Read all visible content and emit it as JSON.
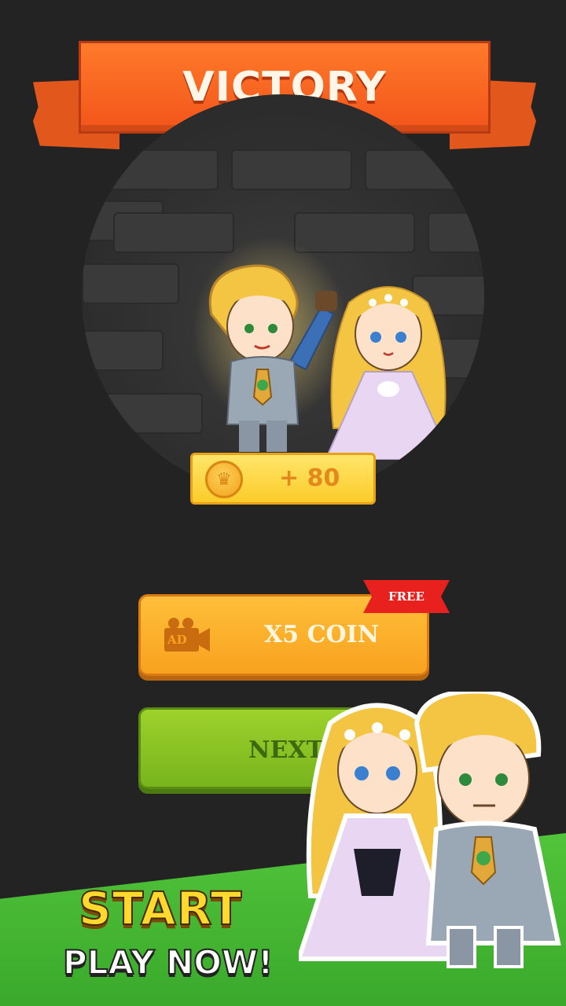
{
  "banner": {
    "title": "VICTORY"
  },
  "reward": {
    "amount_text": "+ 80",
    "coin_icon": "coin-icon"
  },
  "buttons": {
    "coin_label": "X5 COIN",
    "ad_icon_text": "AD",
    "free_badge": "FREE",
    "next_label": "NEXT"
  },
  "promo": {
    "headline": "START",
    "subline": "PLAY NOW!"
  },
  "colors": {
    "banner": "#f2541a",
    "coin_button": "#f8a21f",
    "next_button": "#77b41d",
    "free_badge": "#e8211e",
    "grass": "#3aa92c"
  }
}
